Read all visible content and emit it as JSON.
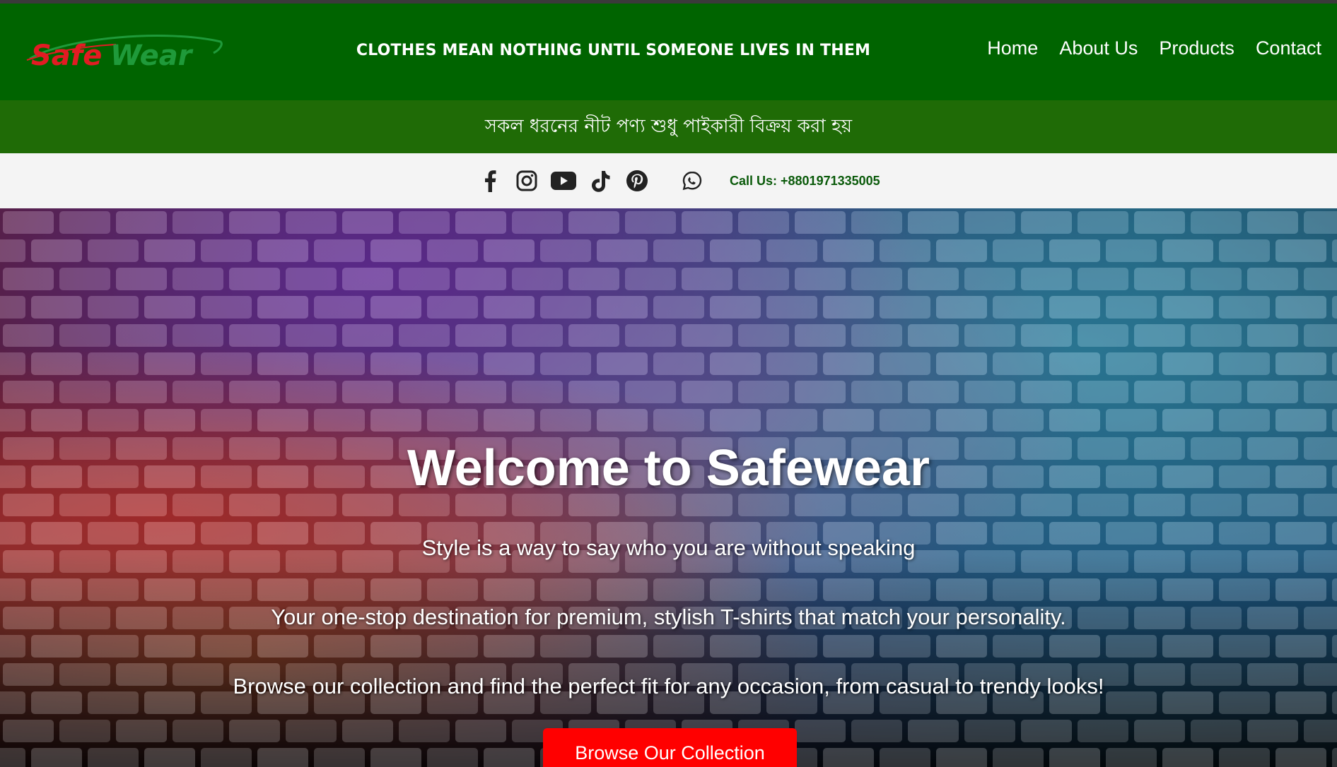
{
  "brand": {
    "logo_text_part1": "Safe",
    "logo_text_part2": "Wear",
    "color_red": "#e31b23",
    "color_green": "#1f9a3a"
  },
  "header": {
    "tagline": "CLOTHES MEAN NOTHING UNTIL SOMEONE LIVES IN THEM",
    "background": "#006400"
  },
  "nav": {
    "items": [
      {
        "label": "Home"
      },
      {
        "label": "About Us"
      },
      {
        "label": "Products"
      },
      {
        "label": "Contact"
      }
    ]
  },
  "notice": {
    "text": "সকল ধরনের নীট পণ্য শুধু পাইকারী বিক্রয় করা হয়",
    "background": "#1f6b06"
  },
  "social": {
    "icons": [
      "facebook-icon",
      "instagram-icon",
      "youtube-icon",
      "tiktok-icon",
      "pinterest-icon",
      "whatsapp-icon"
    ],
    "call_text": "Call Us: +8801971335005"
  },
  "hero": {
    "title": "Welcome to Safewear",
    "line1": "Style is a way to say who you are without speaking",
    "line2": "Your one-stop destination for premium, stylish T-shirts that match your personality.",
    "line3": "Browse our collection and find the perfect fit for any occasion, from casual to trendy looks!",
    "cta_label": "Browse Our Collection",
    "cta_color": "#ff0000"
  }
}
